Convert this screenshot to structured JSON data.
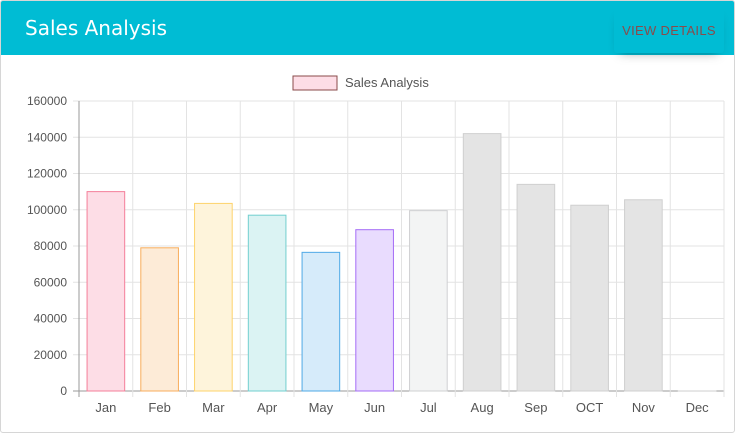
{
  "card": {
    "title": "Sales Analysis",
    "view_details_label": "VIEW DETAILS",
    "header_color": "#00bcd4"
  },
  "chart_data": {
    "type": "bar",
    "legend": {
      "label": "Sales Analysis",
      "placement": "top-center"
    },
    "categories": [
      "Jan",
      "Feb",
      "Mar",
      "Apr",
      "May",
      "Jun",
      "Jul",
      "Aug",
      "Sep",
      "OCT",
      "Nov",
      "Dec"
    ],
    "values": [
      110000,
      79000,
      103500,
      97000,
      76500,
      89000,
      99500,
      142000,
      114000,
      102500,
      105500,
      0
    ],
    "ylim": [
      0,
      160000
    ],
    "yticks": [
      "160000",
      "140000",
      "120000",
      "100000",
      "80000",
      "60000",
      "40000",
      "20000",
      "0"
    ],
    "grid": true,
    "colors": {
      "fills": [
        "#fddde6",
        "#fdebd7",
        "#fef4db",
        "#dbf3f3",
        "#d6ebfa",
        "#e9dcfe",
        "#f3f4f4",
        "#e4e4e4",
        "#e4e4e4",
        "#e4e4e4",
        "#e4e4e4",
        "#e4e4e4"
      ],
      "strokes": [
        "#f47f99",
        "#f8ad5c",
        "#fdd36b",
        "#72cfcf",
        "#4fa9e6",
        "#a46cf6",
        "#cfd0d2",
        "#cfcfcf",
        "#cfcfcf",
        "#cfcfcf",
        "#cfcfcf",
        "#cfcfcf"
      ],
      "legend_fill": "#fddde6",
      "legend_stroke": "#8a4b4b"
    }
  }
}
